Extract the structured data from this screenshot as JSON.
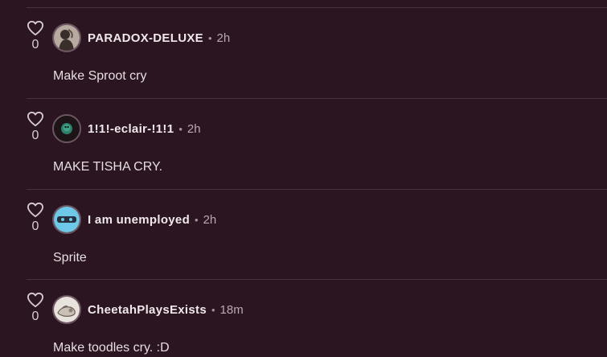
{
  "comments": [
    {
      "username": "PARADOX-DELUXE",
      "time": "2h",
      "text": "Make Sproot cry",
      "likes": "0",
      "avatar_icon": "dark-figure-avatar-icon",
      "avatar_colors": [
        "#b9aaa0",
        "#3a2e2a"
      ]
    },
    {
      "username": "1!1!-eclair-!1!1",
      "time": "2h",
      "text": "MAKE TISHA CRY.",
      "likes": "0",
      "avatar_icon": "green-creature-avatar-icon",
      "avatar_colors": [
        "#1d1418",
        "#3fa58a"
      ]
    },
    {
      "username": "I am unemployed",
      "time": "2h",
      "text": "Sprite",
      "likes": "0",
      "avatar_icon": "cyan-eye-avatar-icon",
      "avatar_colors": [
        "#6ec9e8",
        "#27313d"
      ]
    },
    {
      "username": "CheetahPlaysExists",
      "time": "18m",
      "text": "Make toodles cry. :D",
      "likes": "0",
      "avatar_icon": "hand-sketch-avatar-icon",
      "avatar_colors": [
        "#e8e3dc",
        "#6b5f55"
      ]
    }
  ],
  "separator": "•",
  "theme": {
    "background": "#2b1520",
    "divider": "#4a3140",
    "text": "#e6dde2",
    "muted": "#b9a8b2"
  }
}
